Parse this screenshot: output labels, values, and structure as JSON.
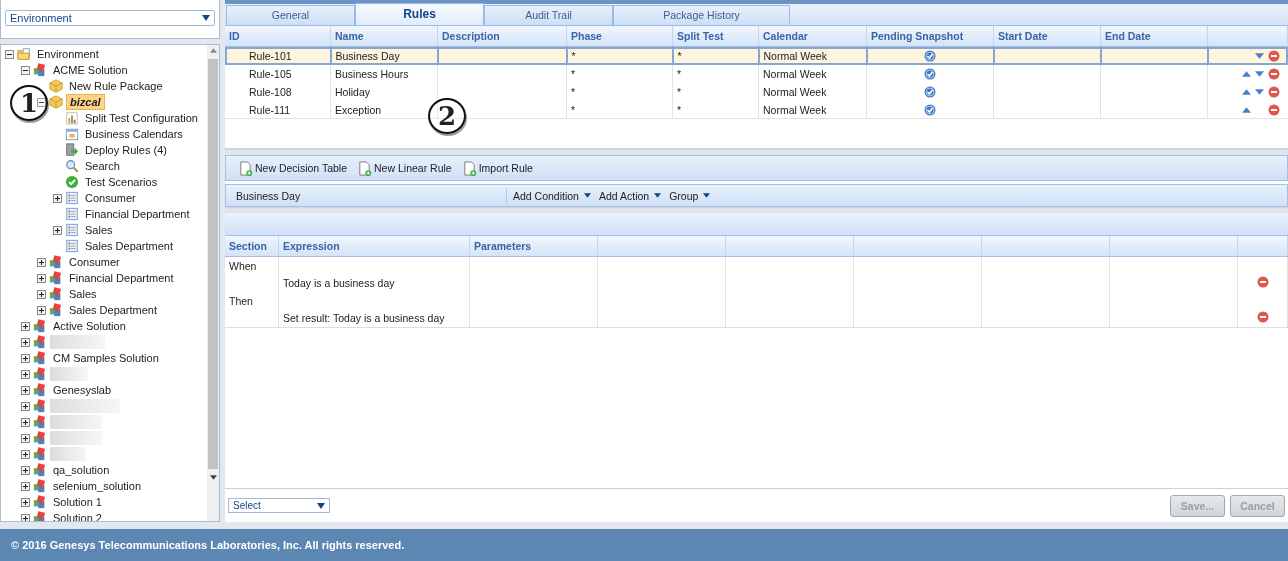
{
  "environment_selector": {
    "value": "Environment"
  },
  "tree": [
    {
      "label": "Environment",
      "kind": "folder",
      "expanded": true,
      "selected": false,
      "children": [
        {
          "label": "ACME Solution",
          "kind": "solution",
          "expanded": true,
          "selected": false,
          "children": [
            {
              "label": "New Rule Package",
              "kind": "package",
              "selected": false
            },
            {
              "label": "bizcal",
              "kind": "package",
              "expanded": true,
              "selected": true,
              "children": [
                {
                  "label": "Split Test Configuration",
                  "kind": "chart",
                  "selected": false
                },
                {
                  "label": "Business Calendars",
                  "kind": "calendar",
                  "selected": false
                },
                {
                  "label": "Deploy Rules (4)",
                  "kind": "deploy",
                  "selected": false
                },
                {
                  "label": "Search",
                  "kind": "search",
                  "selected": false
                },
                {
                  "label": "Test Scenarios",
                  "kind": "check",
                  "selected": false
                },
                {
                  "label": "Consumer",
                  "kind": "list",
                  "expanded": false,
                  "selected": false
                },
                {
                  "label": "Financial Department",
                  "kind": "list",
                  "selected": false
                },
                {
                  "label": "Sales",
                  "kind": "list",
                  "expanded": false,
                  "selected": false
                },
                {
                  "label": "Sales Department",
                  "kind": "list",
                  "selected": false
                }
              ]
            },
            {
              "label": "Consumer",
              "kind": "solution",
              "expanded": false,
              "selected": false
            },
            {
              "label": "Financial Department",
              "kind": "solution",
              "expanded": false,
              "selected": false
            },
            {
              "label": "Sales",
              "kind": "solution",
              "expanded": false,
              "selected": false
            },
            {
              "label": "Sales Department",
              "kind": "solution",
              "expanded": false,
              "selected": false
            }
          ]
        },
        {
          "label": "Active Solution",
          "kind": "solution",
          "expanded": false,
          "selected": false
        },
        {
          "kind": "redacted",
          "expanded": false,
          "selected": false
        },
        {
          "label": "CM Samples Solution",
          "kind": "solution",
          "expanded": false,
          "selected": false
        },
        {
          "kind": "redacted",
          "expanded": false,
          "selected": false
        },
        {
          "label": "Genesyslab",
          "kind": "solution",
          "expanded": false,
          "selected": false
        },
        {
          "kind": "redacted",
          "expanded": false,
          "selected": false
        },
        {
          "kind": "redacted",
          "expanded": false,
          "selected": false
        },
        {
          "kind": "redacted",
          "expanded": false,
          "selected": false
        },
        {
          "kind": "redacted",
          "expanded": false,
          "selected": false
        },
        {
          "label": "qa_solution",
          "kind": "solution",
          "expanded": false,
          "selected": false
        },
        {
          "label": "selenium_solution",
          "kind": "solution",
          "expanded": false,
          "selected": false
        },
        {
          "label": "Solution 1",
          "kind": "solution",
          "expanded": false,
          "selected": false
        },
        {
          "label": "Solution 2",
          "kind": "solution",
          "expanded": false,
          "selected": false
        }
      ]
    }
  ],
  "annotations": [
    {
      "label": "1"
    },
    {
      "label": "2"
    }
  ],
  "tabs": [
    {
      "label": "General",
      "selected": false
    },
    {
      "label": "Rules",
      "selected": true
    },
    {
      "label": "Audit Trail",
      "selected": false
    },
    {
      "label": "Package History",
      "selected": false
    }
  ],
  "rules_table": {
    "columns": [
      "ID",
      "Name",
      "Description",
      "Phase",
      "Split Test",
      "Calendar",
      "Pending Snapshot",
      "Start Date",
      "End Date"
    ],
    "rows": [
      {
        "id": "Rule-101",
        "name": "Business Day",
        "phase": "*",
        "split_test": "*",
        "calendar": "Normal Week",
        "pending_snapshot": true,
        "can_move_up": false,
        "can_move_down": true,
        "selected": true
      },
      {
        "id": "Rule-105",
        "name": "Business Hours",
        "phase": "*",
        "split_test": "*",
        "calendar": "Normal Week",
        "pending_snapshot": true,
        "can_move_up": true,
        "can_move_down": true,
        "selected": false
      },
      {
        "id": "Rule-108",
        "name": "Holiday",
        "phase": "*",
        "split_test": "*",
        "calendar": "Normal Week",
        "pending_snapshot": true,
        "can_move_up": true,
        "can_move_down": true,
        "selected": false
      },
      {
        "id": "Rule-111",
        "name": "Exception",
        "phase": "*",
        "split_test": "*",
        "calendar": "Normal Week",
        "pending_snapshot": true,
        "can_move_up": true,
        "can_move_down": false,
        "selected": false
      }
    ]
  },
  "toolbar": [
    "New Decision Table",
    "New Linear Rule",
    "Import Rule"
  ],
  "rule_bar": {
    "name": "Business Day",
    "menus": [
      "Add Condition",
      "Add Action",
      "Group"
    ]
  },
  "rule_editor": {
    "columns": [
      "Section",
      "Expression",
      "Parameters"
    ],
    "rows": [
      {
        "section": "When"
      },
      {
        "expression": "Today is a business day",
        "deletable": true
      },
      {
        "section": "Then"
      },
      {
        "expression": "Set result: Today is a business day",
        "deletable": true
      }
    ]
  },
  "bottom_bar": {
    "select": "Select",
    "buttons": [
      {
        "label": "Save...",
        "disabled": true
      },
      {
        "label": "Cancel",
        "disabled": true
      }
    ]
  },
  "footer": "© 2016 Genesys Telecommunications Laboratories, Inc. All rights reserved."
}
